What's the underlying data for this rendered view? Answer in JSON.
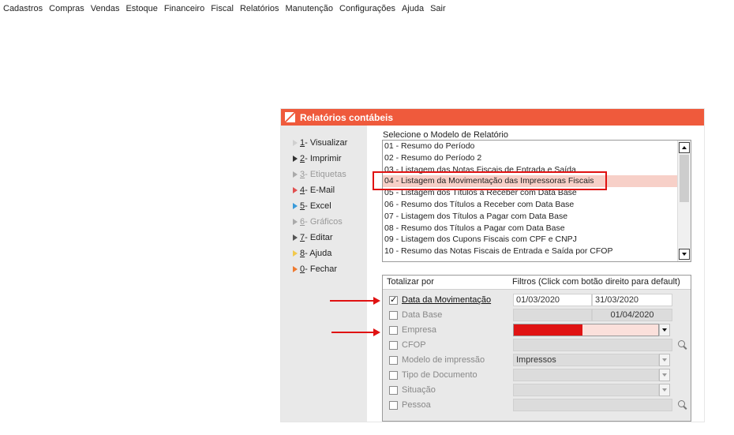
{
  "menu": [
    "Cadastros",
    "Compras",
    "Vendas",
    "Estoque",
    "Financeiro",
    "Fiscal",
    "Relatórios",
    "Manutenção",
    "Configurações",
    "Ajuda",
    "Sair"
  ],
  "dialog": {
    "title": "Relatórios contábeis",
    "actions": [
      {
        "key": "1",
        "label": " - Visualizar",
        "enabled": true,
        "icon_color": "#d0d0d0"
      },
      {
        "key": "2",
        "label": " - Imprimir",
        "enabled": true,
        "icon_color": "#333333"
      },
      {
        "key": "3",
        "label": " - Etiquetas",
        "enabled": false,
        "icon_color": "#aaaaaa"
      },
      {
        "key": "4",
        "label": " - E-Mail",
        "enabled": true,
        "icon_color": "#e05050"
      },
      {
        "key": "5",
        "label": " - Excel",
        "enabled": true,
        "icon_color": "#3a9ad9"
      },
      {
        "key": "6",
        "label": " - Gráficos",
        "enabled": false,
        "icon_color": "#aaaaaa"
      },
      {
        "key": "7",
        "label": " - Editar",
        "enabled": true,
        "icon_color": "#555555"
      },
      {
        "key": "8",
        "label": " - Ajuda",
        "enabled": true,
        "icon_color": "#f2c94c"
      },
      {
        "key": "0",
        "label": " - Fechar",
        "enabled": true,
        "icon_color": "#ef7a30"
      }
    ],
    "select_label": "Selecione o Modelo de Relatório",
    "reports": [
      "01 - Resumo do Período",
      "02 - Resumo do Período 2",
      "03 - Listagem das Notas Fiscais de Entrada e Saída",
      "04 - Listagem da Movimentação das Impressoras Fiscais",
      "05 - Listagem dos Títulos  a Receber com Data Base",
      "06 - Resumo dos Títulos  a Receber com Data Base",
      "07 - Listagem dos Títulos  a Pagar com Data Base",
      "08 - Resumo dos Títulos  a Pagar com Data Base",
      "09 - Listagem dos Cupons Fiscais com CPF e CNPJ",
      "10 - Resumo das Notas Fiscais de Entrada e Saída por CFOP"
    ],
    "selected_report_index": 3,
    "filters": {
      "header_left": "Totalizar por",
      "header_right": "Filtros (Click com botão direito para default)",
      "rows": [
        {
          "label": "Data da Movimentação",
          "checked": true,
          "value1": "01/03/2020",
          "value2": "31/03/2020"
        },
        {
          "label": "Data Base",
          "checked": false,
          "value2": "01/04/2020"
        },
        {
          "label": "Empresa",
          "checked": false
        },
        {
          "label": "CFOP",
          "checked": false
        },
        {
          "label": "Modelo de impressão",
          "checked": false,
          "value1": "Impressos"
        },
        {
          "label": "Tipo de Documento",
          "checked": false
        },
        {
          "label": "Situação",
          "checked": false
        },
        {
          "label": "Pessoa",
          "checked": false
        }
      ]
    }
  },
  "colors": {
    "accent": "#ef5a3c",
    "highlight": "#e01212",
    "selected_row": "#f7d0c8"
  }
}
